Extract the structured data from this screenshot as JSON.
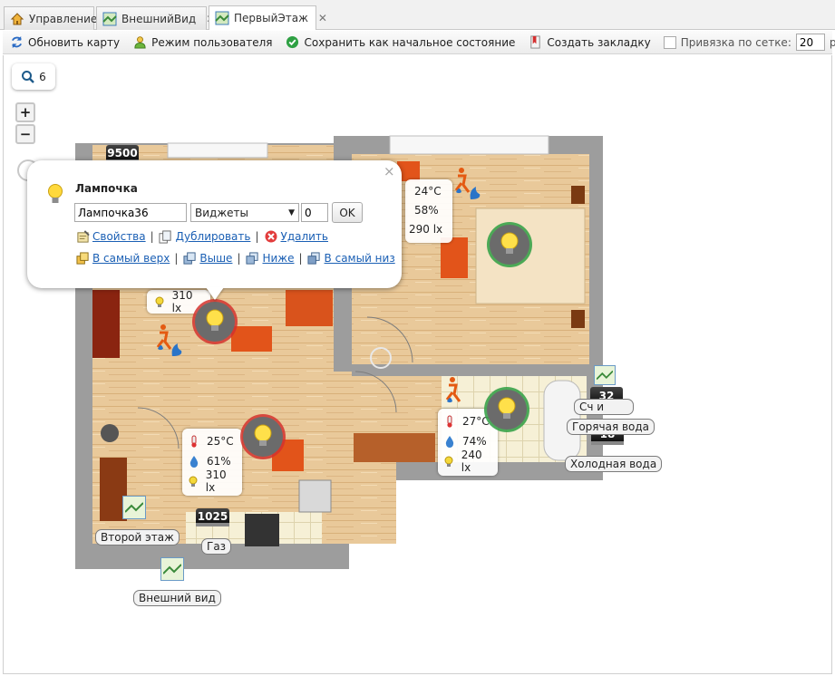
{
  "tabs": [
    {
      "label": "Управление",
      "icon": "home-icon",
      "closable": false,
      "active": false
    },
    {
      "label": "ВнешнийВид",
      "icon": "map-icon",
      "closable": true,
      "active": false
    },
    {
      "label": "ПервыйЭтаж",
      "icon": "map-icon",
      "closable": true,
      "active": true
    }
  ],
  "toolbar": {
    "refresh_label": "Обновить карту",
    "user_mode_label": "Режим пользователя",
    "save_state_label": "Сохранить как начальное состояние",
    "bookmark_label": "Создать закладку",
    "grid_snap_label": "Привязка по сетке:",
    "grid_value": "20",
    "grid_unit": "px"
  },
  "map": {
    "search_count": "6",
    "zoom_in": "+",
    "zoom_out": "−"
  },
  "popup": {
    "title": "Лампочка",
    "name_value": "Лампочка36",
    "type_value": "Виджеты",
    "index_value": "0",
    "ok_label": "OK",
    "close_glyph": "×",
    "actions_row1": [
      "Свойства",
      "Дублировать",
      "Удалить"
    ],
    "actions_row2": [
      "В самый верх",
      "Выше",
      "Ниже",
      "В самый низ"
    ]
  },
  "sensors": {
    "living_lux": "310 lx",
    "bedroom": {
      "temp": "24°C",
      "humidity": "58%",
      "lux": "290 lx"
    },
    "kitchen": {
      "temp": "25°C",
      "humidity": "61%",
      "lux": "310 lx"
    },
    "bath": {
      "temp": "27°C",
      "humidity": "74%",
      "lux": "240 lx"
    }
  },
  "counters": {
    "top": "9500",
    "gas": "1025",
    "hot": "32",
    "cold": "18"
  },
  "labels": {
    "second_floor": "Второй этаж",
    "outside": "Внешний вид",
    "gas": "Газ",
    "hot_water": "Горячая вода",
    "cold_water": "Холодная вода",
    "partial": "Сч         и"
  },
  "colors": {
    "accent": "#1a5fb4",
    "wall": "#9c9c9c",
    "floor": "#e8c89c",
    "bulb_ring_green": "#3aa24a",
    "bulb_ring_red": "#d4332e"
  }
}
